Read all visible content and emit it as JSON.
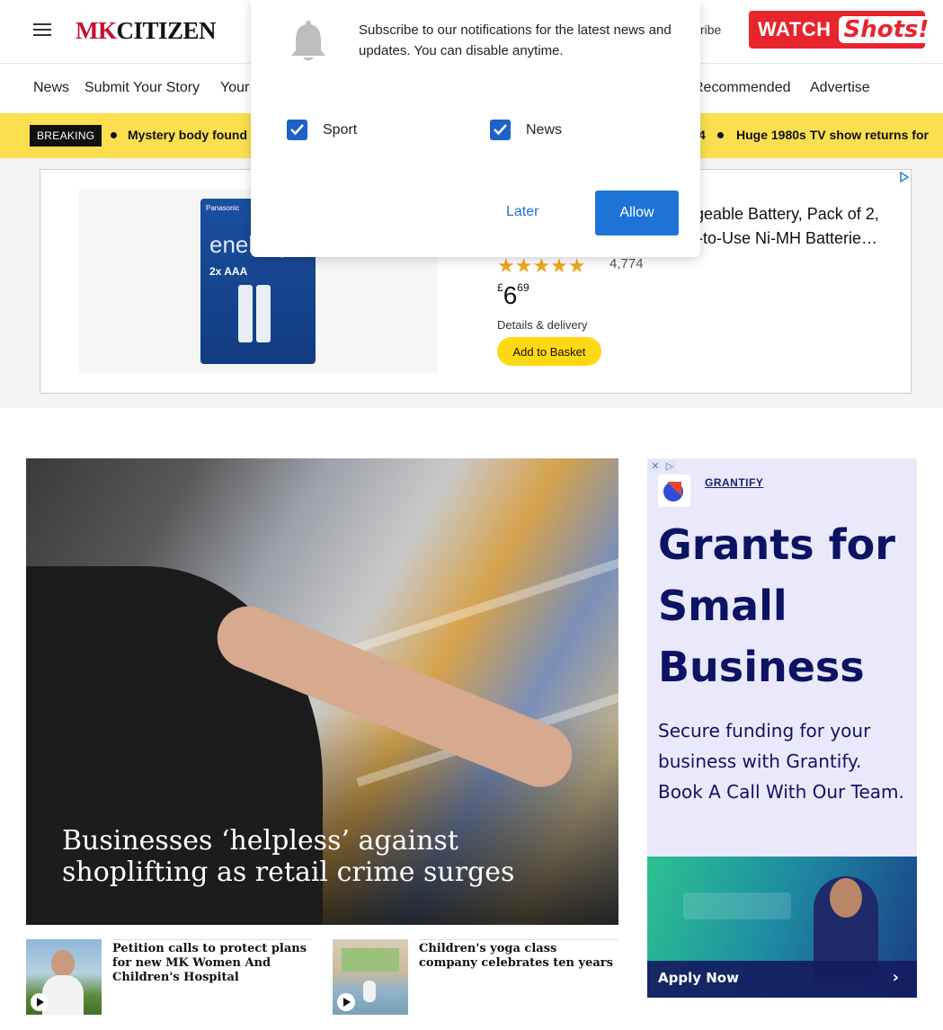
{
  "header": {
    "logo_mk": "MK",
    "logo_citizen": "CITIZEN",
    "subscribe_partial": "scribe",
    "watch_label": "WATCH",
    "shots_label": "Shots!"
  },
  "nav": {
    "items": [
      "News",
      "Submit Your Story",
      "Your",
      "Recommended",
      "Advertise"
    ]
  },
  "breaking": {
    "label": "BREAKING",
    "items": [
      "Mystery body found",
      "4",
      "Huge 1980s TV show returns for"
    ]
  },
  "ad": {
    "pack_brand": "Panasonic",
    "pack_name": "eneloop",
    "pack_aaa": "2x AAA",
    "title_line1": "rgeable Battery, Pack of 2,",
    "title_line2": "y-to-Use Ni-MH Batterie…",
    "stars": "★★★★★",
    "rating_value": 4.5,
    "rating_count": "4,774",
    "price_currency": "£",
    "price_main": "6",
    "price_pence": "69",
    "details": "Details & delivery",
    "basket": "Add to Basket"
  },
  "modal": {
    "message": "Subscribe to our notifications for the latest news and updates. You can disable anytime.",
    "options": [
      {
        "label": "Sport",
        "checked": true
      },
      {
        "label": "News",
        "checked": true
      }
    ],
    "later": "Later",
    "allow": "Allow",
    "accent": "#1e73d6"
  },
  "hero": {
    "headline": "Businesses ‘helpless’ against shoplifting as retail crime surges"
  },
  "stories": [
    {
      "title": "Petition calls to protect plans for new MK Women And Children's Hospital"
    },
    {
      "title": "Children's yoga class company celebrates ten years"
    }
  ],
  "sidead": {
    "brand": "GRANTIFY",
    "headline": "Grants for Small Business",
    "body": "Secure funding for your business with Grantify. Book A Call With Our Team.",
    "cta": "Apply Now"
  },
  "colors": {
    "brand_red": "#c8102e",
    "breaking_yellow": "#fcdf4e",
    "watch_red": "#e8242d"
  }
}
